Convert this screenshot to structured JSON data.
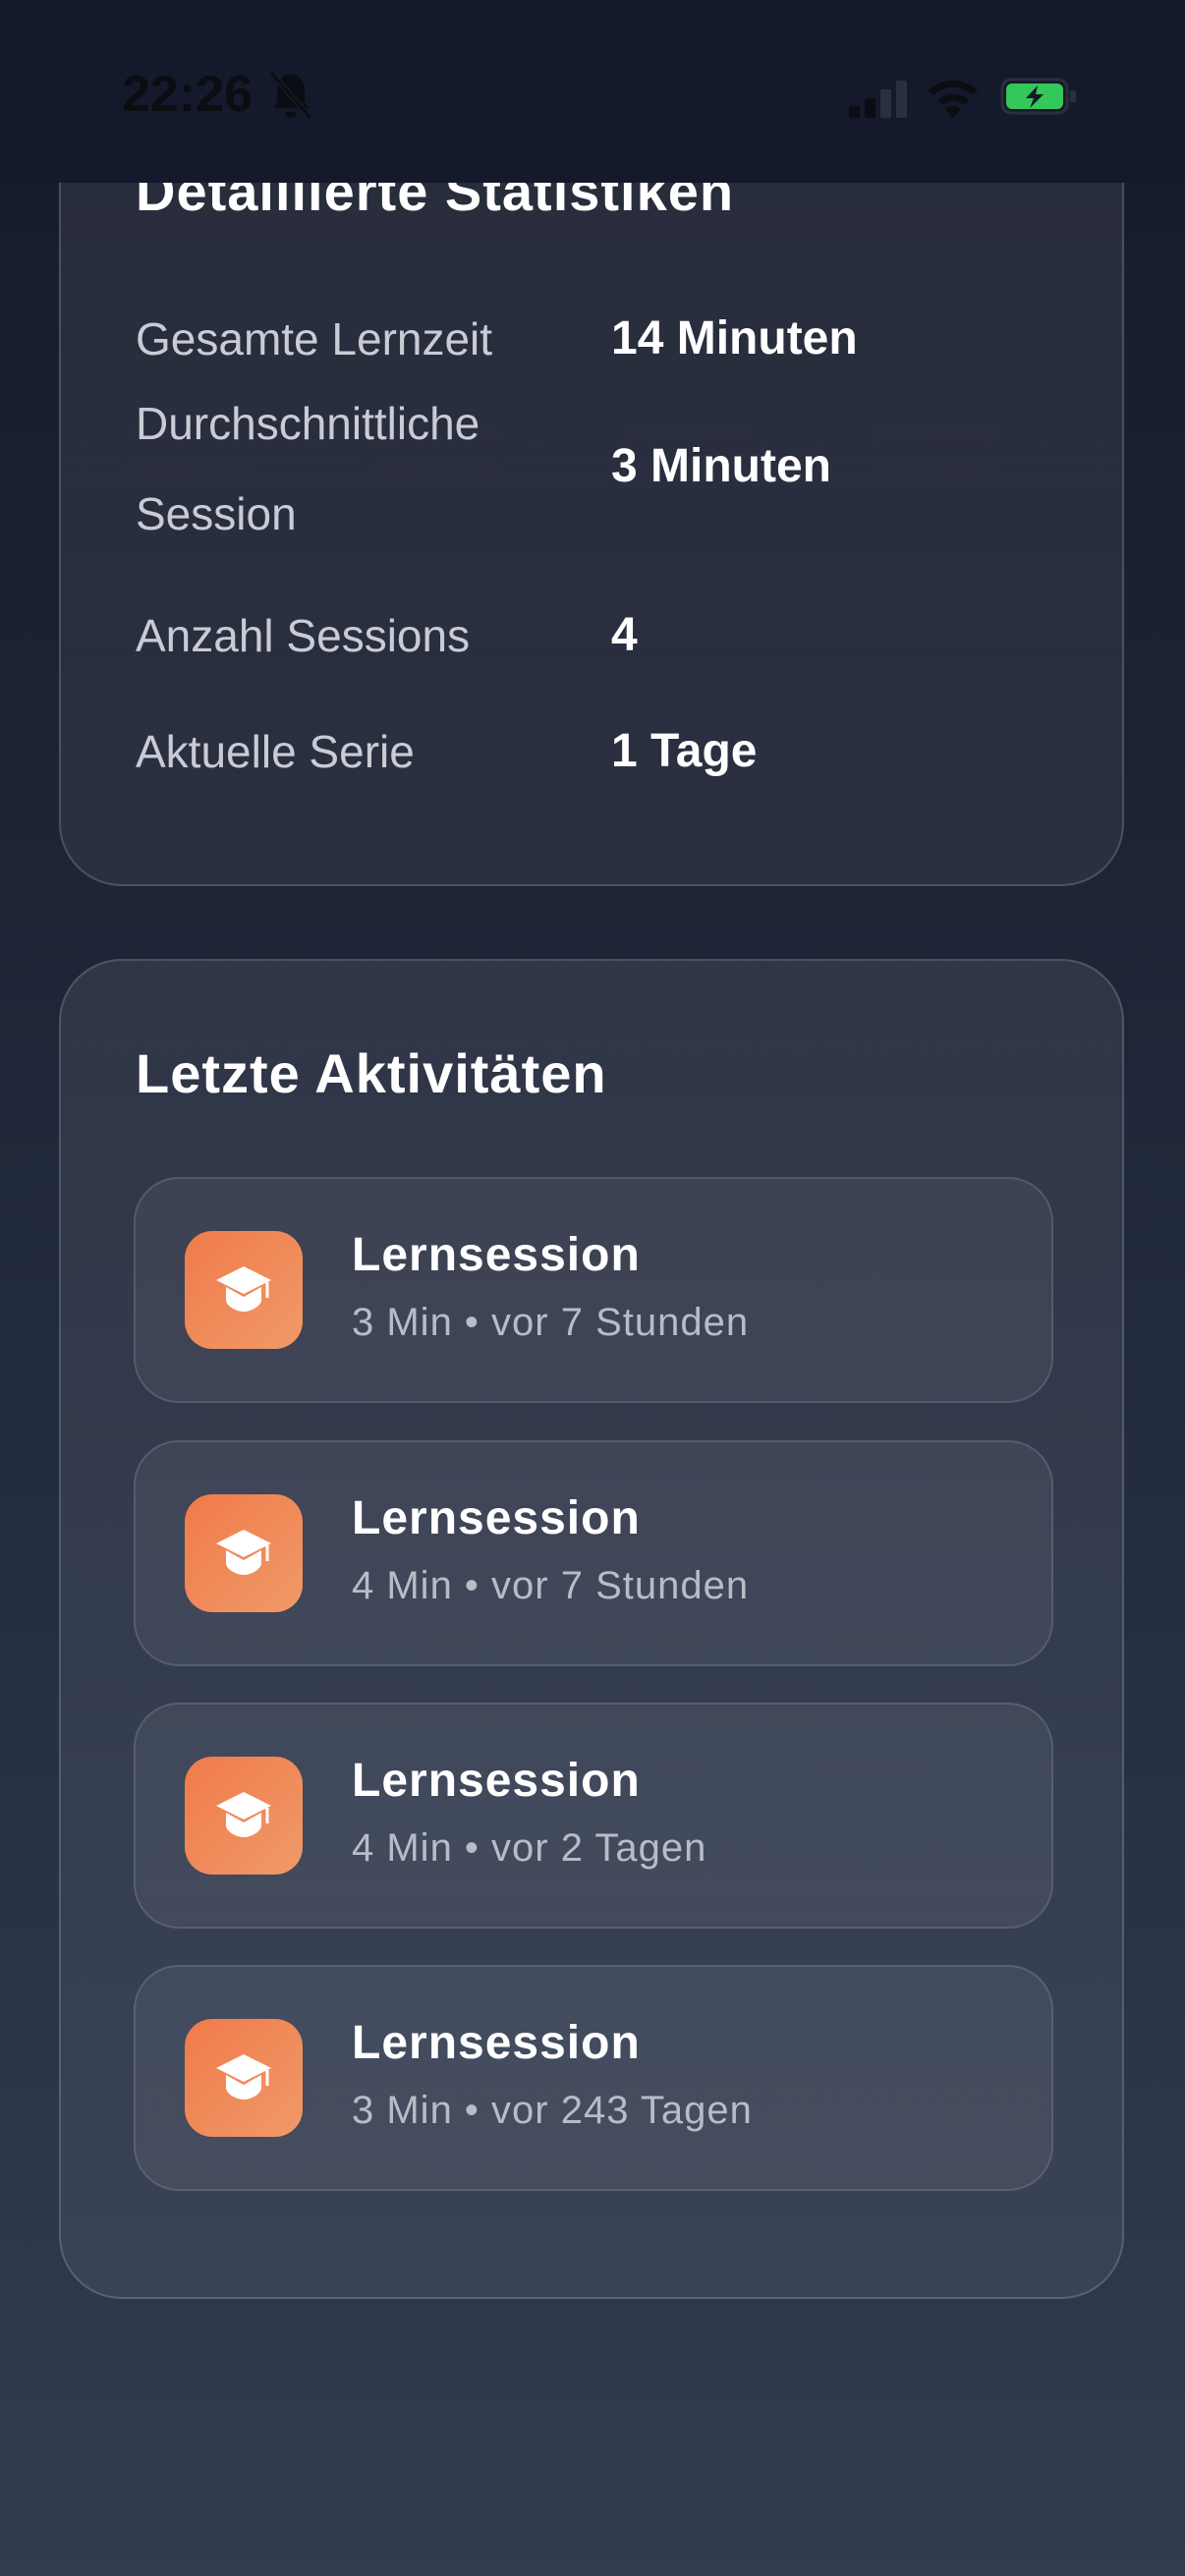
{
  "status_bar": {
    "time": "22:26"
  },
  "stats": {
    "title": "Detaillierte Statistiken",
    "rows": [
      {
        "label": "Gesamte Lernzeit",
        "value": "14 Minuten"
      },
      {
        "label": "Durchschnittliche Session",
        "value": "3 Minuten"
      },
      {
        "label": "Anzahl Sessions",
        "value": "4"
      },
      {
        "label": "Aktuelle Serie",
        "value": "1 Tage"
      }
    ]
  },
  "activities": {
    "title": "Letzte Aktivitäten",
    "items": [
      {
        "name": "Lernsession",
        "meta": "3 Min • vor 7 Stunden",
        "icon": "graduation-cap-icon"
      },
      {
        "name": "Lernsession",
        "meta": "4 Min • vor 7 Stunden",
        "icon": "graduation-cap-icon"
      },
      {
        "name": "Lernsession",
        "meta": "4 Min • vor 2 Tagen",
        "icon": "graduation-cap-icon"
      },
      {
        "name": "Lernsession",
        "meta": "3 Min • vor 243 Tagen",
        "icon": "graduation-cap-icon"
      }
    ]
  },
  "colors": {
    "accent": "#f07a4a",
    "battery": "#34c759"
  }
}
